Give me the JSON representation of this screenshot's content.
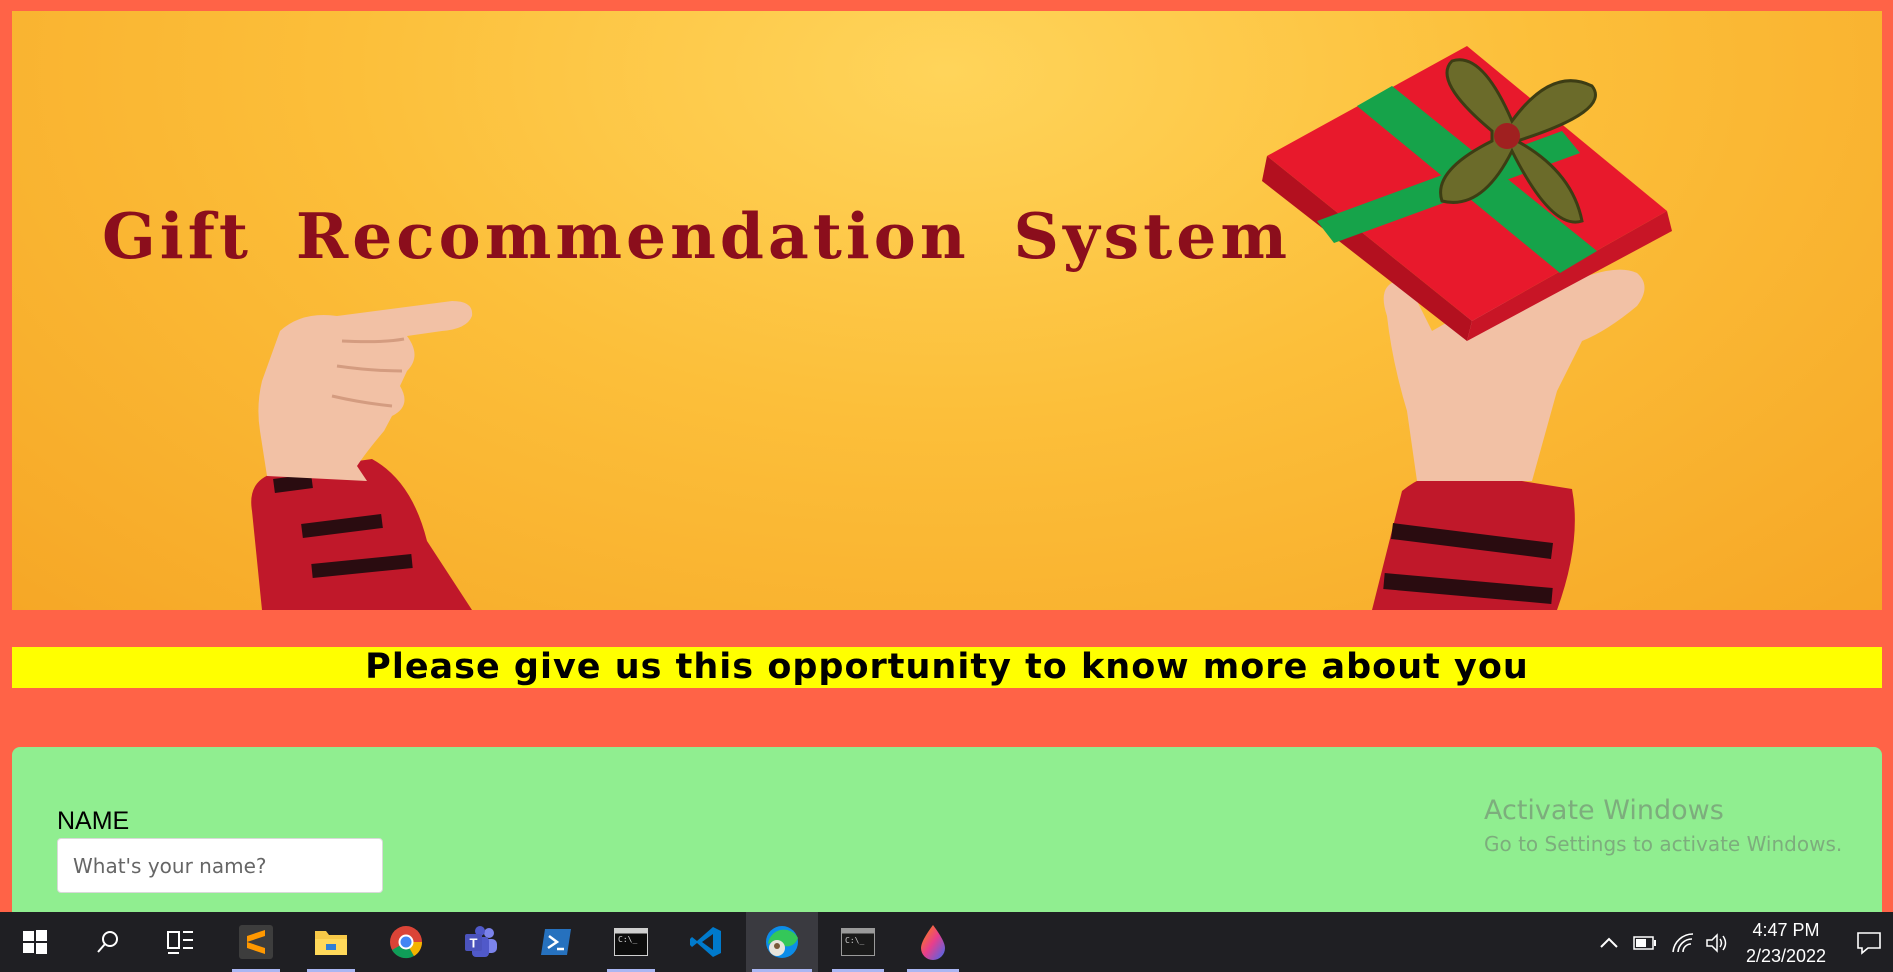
{
  "banner": {
    "title": "Gift Recommendation System"
  },
  "tagline": "Please give us this opportunity to know more about you",
  "form": {
    "name_label": "NAME",
    "name_placeholder": "What's your name?",
    "name_value": ""
  },
  "watermark": {
    "title": "Activate Windows",
    "subtitle": "Go to Settings to activate Windows."
  },
  "taskbar": {
    "pinned": [
      {
        "name": "start-icon",
        "running": false,
        "active": false
      },
      {
        "name": "search-icon",
        "running": false,
        "active": false
      },
      {
        "name": "task-view-icon",
        "running": false,
        "active": false
      },
      {
        "name": "sublime-text-icon",
        "running": true,
        "active": false
      },
      {
        "name": "file-explorer-icon",
        "running": true,
        "active": false
      },
      {
        "name": "chrome-icon",
        "running": false,
        "active": false
      },
      {
        "name": "teams-icon",
        "running": false,
        "active": false
      },
      {
        "name": "powershell-icon",
        "running": false,
        "active": false
      },
      {
        "name": "terminal-icon",
        "running": true,
        "active": false
      },
      {
        "name": "vscode-icon",
        "running": false,
        "active": false
      },
      {
        "name": "edge-icon",
        "running": true,
        "active": true
      },
      {
        "name": "cmd-icon",
        "running": true,
        "active": false
      },
      {
        "name": "paint-icon",
        "running": true,
        "active": false
      }
    ],
    "tray": [
      "chevron-up-icon",
      "battery-icon",
      "wifi-icon",
      "volume-icon",
      "notification-icon"
    ],
    "time": "4:47 PM",
    "date": "2/23/2022"
  },
  "colors": {
    "page_bg": "#ff6347",
    "tagline_bg": "#ffff00",
    "form_bg": "#90ee90",
    "title_color": "#8b0e1c",
    "taskbar_bg": "#1f1f23"
  }
}
